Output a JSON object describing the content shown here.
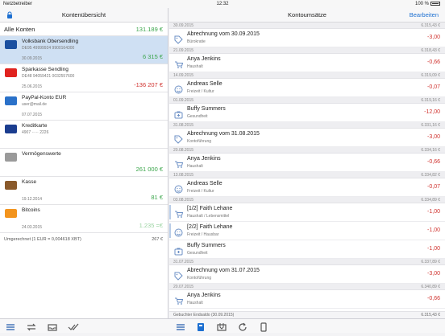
{
  "status": {
    "carrier": "Netzbetreiber",
    "time": "12:32",
    "battery": "100 %"
  },
  "left": {
    "title": "Kontenübersicht",
    "all": {
      "label": "Alle Konten",
      "amount": "131.189 €"
    },
    "accounts": [
      {
        "name": "Volksbank Obersendling",
        "sub": "DE95 49999924 9900164300",
        "date": "30.09.2015",
        "amount": "6 315 €",
        "cls": "pos",
        "icon": "volksbank-icon",
        "color": "#1a4fa0",
        "selected": true
      },
      {
        "name": "Sparkasse Sendling",
        "sub": "DE48 94059421 0032557600",
        "date": "25.06.2015",
        "amount": "-136 207 €",
        "cls": "neg",
        "icon": "sparkasse-icon",
        "color": "#e0231f"
      },
      {
        "name": "PayPal-Konto EUR",
        "sub": "user@mail.de",
        "date": "07.07.2015",
        "amount": "",
        "cls": "pos",
        "icon": "paypal-icon",
        "color": "#2a71c9"
      },
      {
        "name": "Kreditkarte",
        "sub": "4907 ····· 2226",
        "date": "",
        "amount": "",
        "cls": "pos",
        "icon": "visa-icon",
        "color": "#1b3d8f"
      },
      {
        "name": "Vermögenswerte",
        "sub": "",
        "date": "",
        "amount": "261 000 €",
        "cls": "pos",
        "icon": "assets-icon",
        "color": "#9a9a9a"
      },
      {
        "name": "Kasse",
        "sub": "",
        "date": "19.12.2014",
        "amount": "81 €",
        "cls": "pos",
        "icon": "cash-icon",
        "color": "#8a5a2b"
      },
      {
        "name": "Bitcoins",
        "sub": "",
        "date": "24.03.2015",
        "amount": "1.235 =€",
        "cls": "light-pos",
        "icon": "bitcoin-icon",
        "color": "#f3941d"
      }
    ],
    "conversion": {
      "label": "Umgerechnet (1 EUR = 0,004618 XBT)",
      "value": "267 €"
    }
  },
  "right": {
    "title": "Kontoumsätze",
    "edit": "Bearbeiten",
    "groups": [
      {
        "date": "30.09.2015",
        "balance": "6.315,43 €",
        "tx": [
          {
            "title": "Abrechnung vom  30.09.2015",
            "cat": "Bürokratie",
            "amount": "-3,00",
            "icon": "tag-icon"
          }
        ]
      },
      {
        "date": "21.09.2015",
        "balance": "6.318,43 €",
        "tx": [
          {
            "title": "Anya Jenkins",
            "cat": "Haushalt",
            "amount": "-0,66",
            "icon": "cart-icon"
          }
        ]
      },
      {
        "date": "14.09.2015",
        "balance": "6.319,09 €",
        "tx": [
          {
            "title": "Andreas Selle",
            "cat": "Freizeit / Kultur",
            "amount": "-0,07",
            "icon": "smiley-icon"
          }
        ]
      },
      {
        "date": "01.09.2015",
        "balance": "6.319,16 €",
        "tx": [
          {
            "title": "Buffy Summers",
            "cat": "Gesundheit",
            "amount": "-12,00",
            "icon": "medkit-icon"
          }
        ]
      },
      {
        "date": "31.08.2015",
        "balance": "6.331,16 €",
        "tx": [
          {
            "title": "Abrechnung vom  31.08.2015",
            "cat": "Kontoführung",
            "amount": "-3,00",
            "icon": "tag-icon"
          }
        ]
      },
      {
        "date": "20.08.2015",
        "balance": "6.334,16 €",
        "tx": [
          {
            "title": "Anya Jenkins",
            "cat": "Haushalt",
            "amount": "-0,66",
            "icon": "cart-icon"
          }
        ]
      },
      {
        "date": "13.08.2015",
        "balance": "6.334,82 €",
        "tx": [
          {
            "title": "Andreas Selle",
            "cat": "Freizeit / Kultur",
            "amount": "-0,07",
            "icon": "smiley-icon"
          }
        ]
      },
      {
        "date": "03.08.2015",
        "balance": "6.334,89 €",
        "tx": [
          {
            "title": "[1/2] Faith Lehane",
            "cat": "Haushalt / Lebensmittel",
            "amount": "-1,00",
            "icon": "cart-icon",
            "mark": true
          },
          {
            "title": "[2/2] Faith Lehane",
            "cat": "Freizeit / Hausbar",
            "amount": "-1,00",
            "icon": "smiley-icon",
            "mark": true
          },
          {
            "title": "Buffy Summers",
            "cat": "Gesundheit",
            "amount": "-1,00",
            "icon": "medkit-icon"
          }
        ]
      },
      {
        "date": "31.07.2015",
        "balance": "6.337,89 €",
        "tx": [
          {
            "title": "Abrechnung vom  31.07.2015",
            "cat": "Kontoführung",
            "amount": "-3,00",
            "icon": "tag-icon"
          }
        ]
      },
      {
        "date": "20.07.2015",
        "balance": "6.340,89 €",
        "tx": [
          {
            "title": "Anya Jenkins",
            "cat": "Haushalt",
            "amount": "-0,66",
            "icon": "cart-icon"
          }
        ]
      }
    ],
    "footer": {
      "label": "Gebuchter Endsaldo (30.09.2015)",
      "balance": "6.315,43 €"
    }
  }
}
